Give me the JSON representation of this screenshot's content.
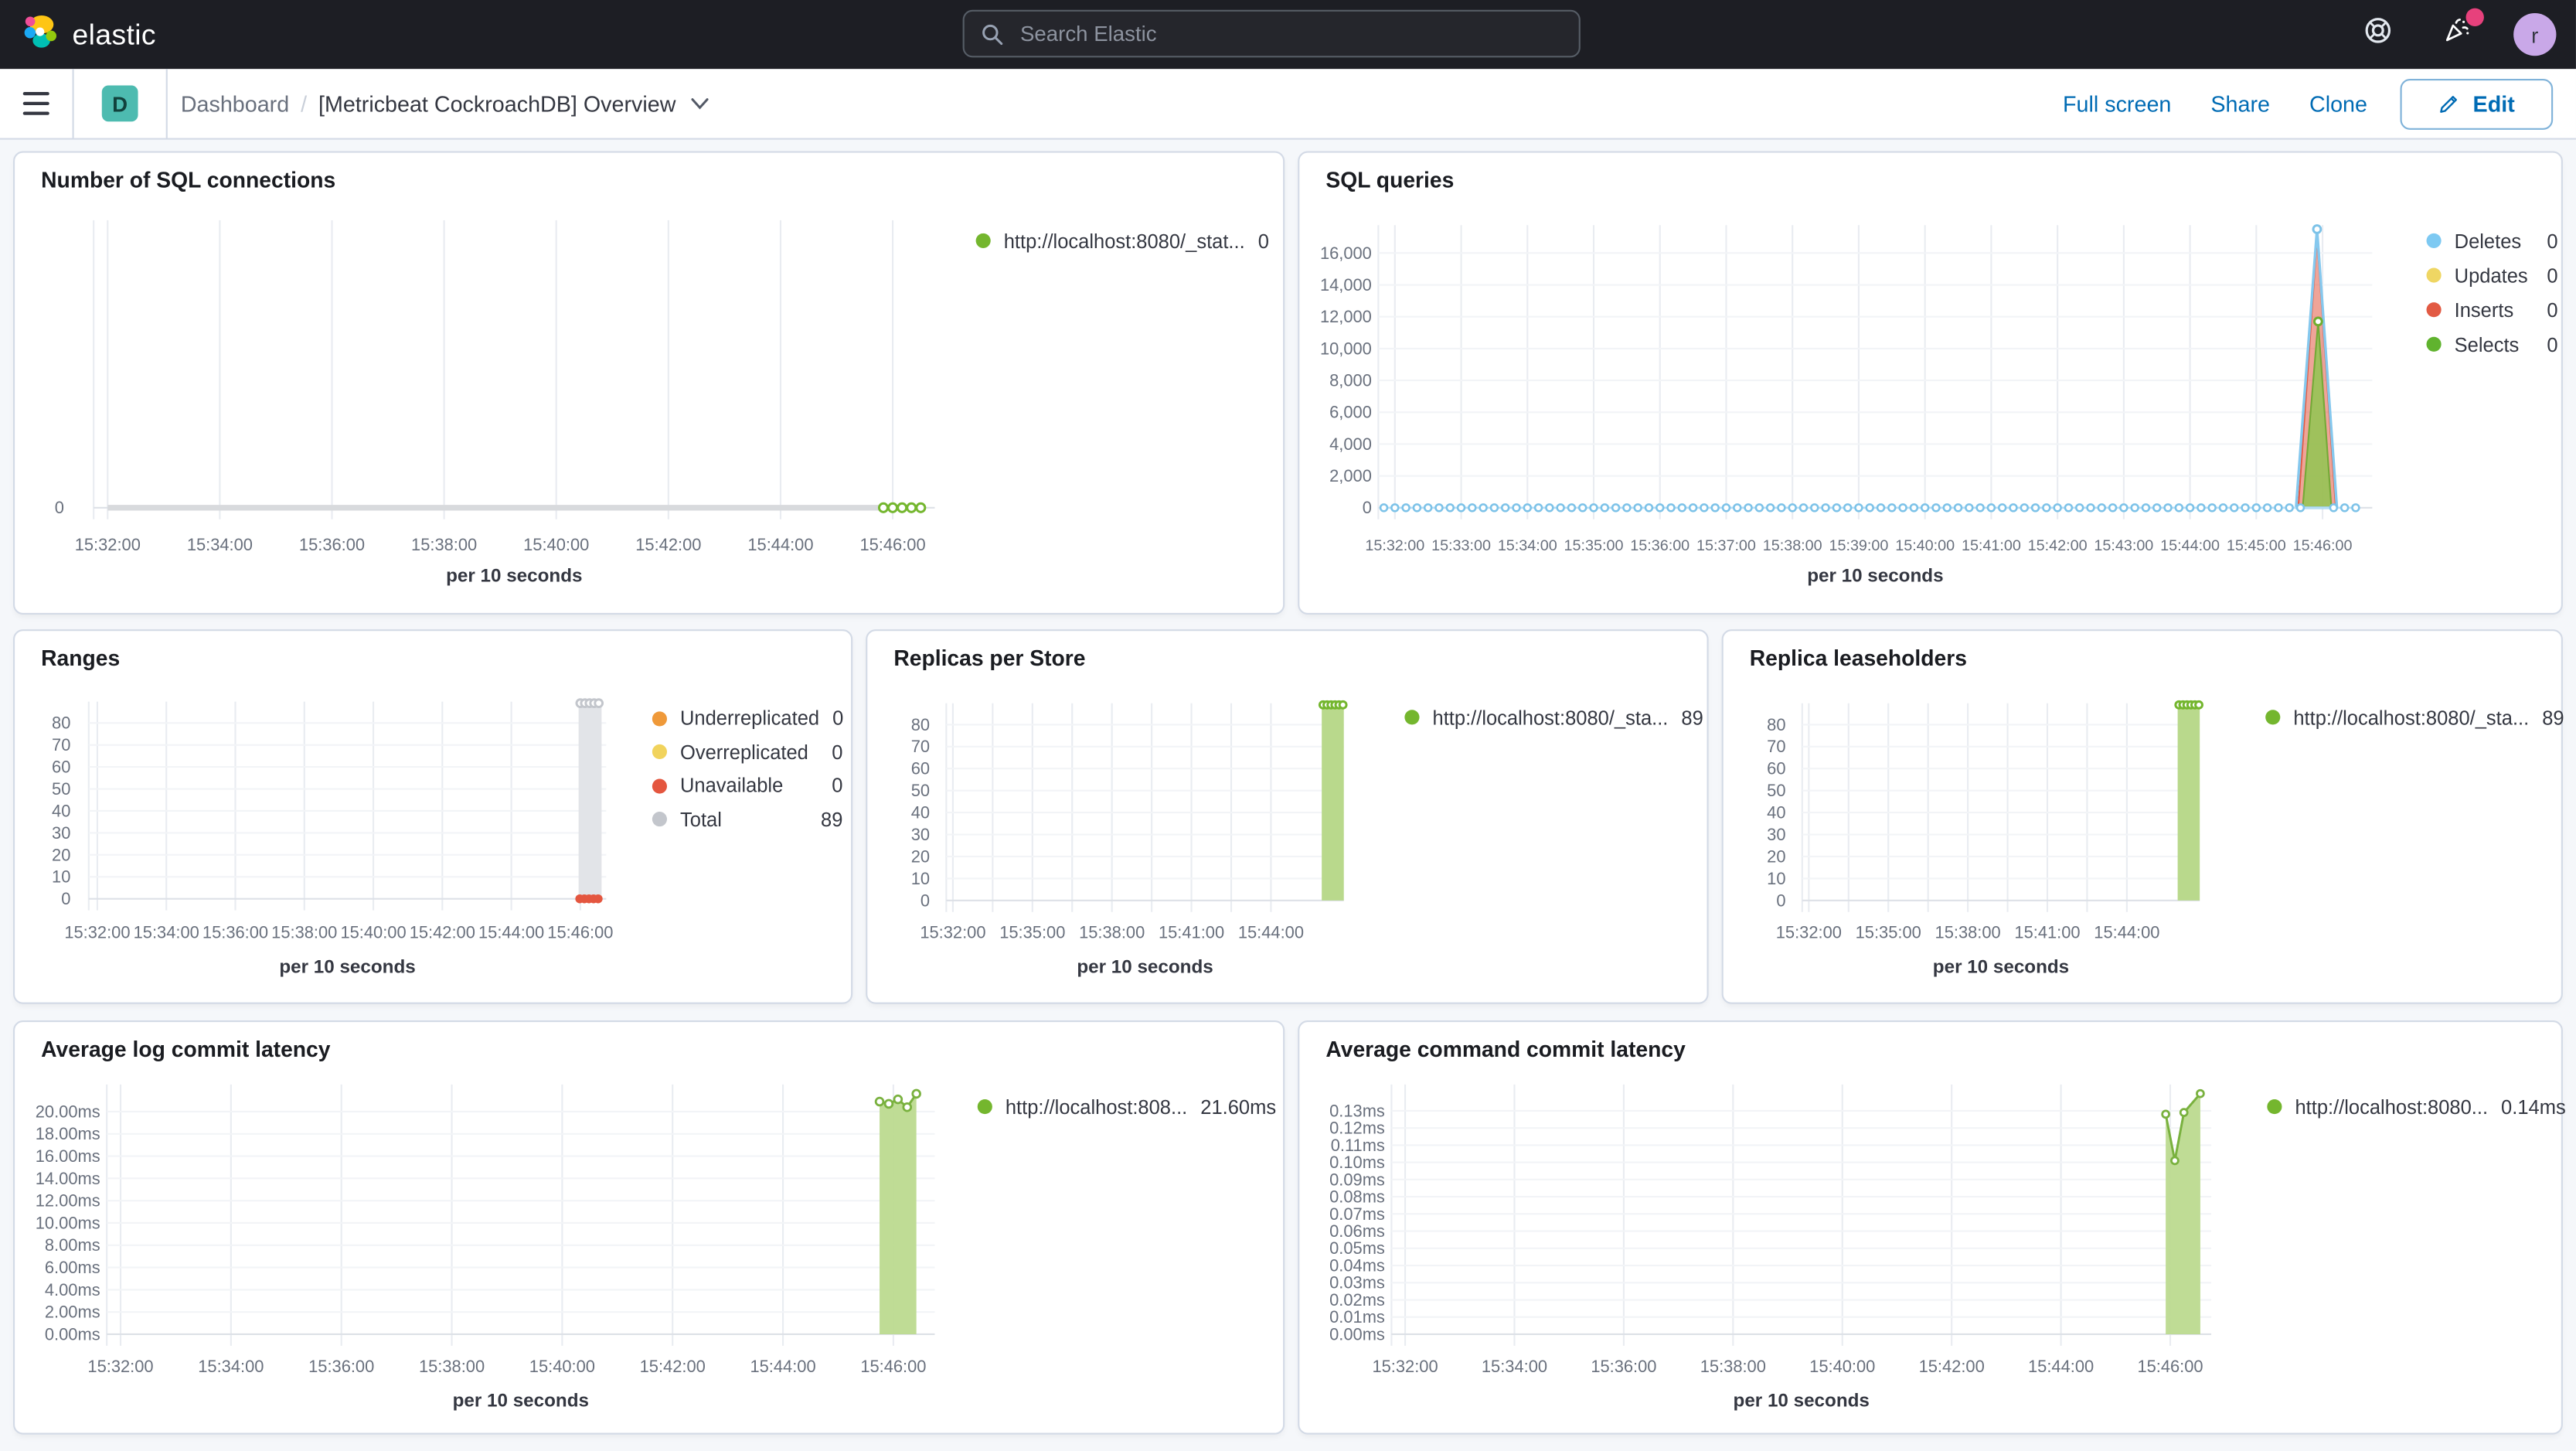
{
  "chrome": {
    "brand": "elastic",
    "search_placeholder": "Search Elastic",
    "avatar_initial": "r",
    "notification_color": "#e7417c"
  },
  "toolbar": {
    "badge": "D",
    "breadcrumb_root": "Dashboard",
    "breadcrumb_sep": "/",
    "title": "[Metricbeat CockroachDB] Overview",
    "actions": [
      "Full screen",
      "Share",
      "Clone"
    ],
    "edit_label": "Edit"
  },
  "colors": {
    "topbar_bg": "#1d1e24",
    "page_bg": "#f5f7fa",
    "panel_border": "#d3dae6",
    "link_blue": "#006bb4",
    "green_series": "#74b62e",
    "green_fill": "#bcda8f",
    "blue_series": "#7cc2e8",
    "red_series": "#e25a43",
    "yellow_series": "#efd663",
    "orange_series": "#ef9939",
    "gray_series": "#c3c6cc"
  },
  "chart_data": {
    "sql_connections": {
      "type": "line",
      "title": "Number of SQL connections",
      "xlabel": "per 10 seconds",
      "time_range": [
        "15:31:45",
        "15:46:45"
      ],
      "x_ticks": [
        "15:32:00",
        "15:34:00",
        "15:36:00",
        "15:38:00",
        "15:40:00",
        "15:42:00",
        "15:44:00",
        "15:46:00"
      ],
      "y_ticks": [
        [
          "0",
          0
        ]
      ],
      "legend": [
        {
          "label": "http://localhost:8080/_stat...",
          "value": "0",
          "color": "#74b62e"
        }
      ],
      "draw": [
        {
          "kind": "hline",
          "v": 0,
          "t0": "15:32:00",
          "t1": "15:45:50",
          "color": "#d8dadd",
          "w": 3.5
        },
        {
          "kind": "hollow",
          "r": 2.6,
          "color": "#74b62e",
          "pts": [
            [
              "15:45:50",
              0
            ],
            [
              "15:46:00",
              0
            ],
            [
              "15:46:10",
              0
            ],
            [
              "15:46:20",
              0
            ],
            [
              "15:46:30",
              0
            ]
          ]
        }
      ]
    },
    "sql_queries": {
      "type": "line",
      "title": "SQL queries",
      "xlabel": "per 10 seconds",
      "time_range": [
        "15:31:45",
        "15:46:45"
      ],
      "x_ticks": [
        "15:32:00",
        "15:33:00",
        "15:34:00",
        "15:35:00",
        "15:36:00",
        "15:37:00",
        "15:38:00",
        "15:39:00",
        "15:40:00",
        "15:41:00",
        "15:42:00",
        "15:43:00",
        "15:44:00",
        "15:45:00",
        "15:46:00"
      ],
      "y_ticks": [
        [
          "16,000",
          16000
        ],
        [
          "14,000",
          14000
        ],
        [
          "12,000",
          12000
        ],
        [
          "10,000",
          10000
        ],
        [
          "8,000",
          8000
        ],
        [
          "6,000",
          6000
        ],
        [
          "4,000",
          4000
        ],
        [
          "2,000",
          2000
        ],
        [
          "0",
          0
        ]
      ],
      "legend": [
        {
          "label": "Deletes",
          "value": "0",
          "color": "#7dc9f2"
        },
        {
          "label": "Updates",
          "value": "0",
          "color": "#efd663"
        },
        {
          "label": "Inserts",
          "value": "0",
          "color": "#e25a43"
        },
        {
          "label": "Selects",
          "value": "0",
          "color": "#60b32e"
        }
      ],
      "draw": [
        {
          "kind": "spike",
          "tl": "15:45:38",
          "tc": "15:45:55",
          "tr": "15:46:12",
          "v": 17000,
          "fill": "rgba(226,90,67,0.55)",
          "stroke": "#e25a43",
          "sw": 1
        },
        {
          "kind": "spike",
          "tl": "15:45:42",
          "tc": "15:45:56",
          "tr": "15:46:08",
          "v": 11700,
          "fill": "rgba(150,196,85,0.9)",
          "stroke": "#74a937",
          "sw": 1
        },
        {
          "kind": "spike",
          "tl": "15:45:36",
          "tc": "15:45:55",
          "tr": "15:46:13",
          "v": 17500,
          "fill": "none",
          "stroke": "#85c8ee",
          "sw": 1.6
        },
        {
          "kind": "dotline",
          "v": 0,
          "t0": "15:31:50",
          "t1": "15:46:30",
          "step": 10,
          "line": "#b5ddf4",
          "lw": 1.2,
          "stroke": "#7cc2e8",
          "r": 2.1,
          "skip": [
            "15:45:40",
            "15:46:10"
          ]
        },
        {
          "kind": "hollow",
          "r": 2.3,
          "color": "#7cc2e8",
          "pts": [
            [
              "15:45:55",
              17500
            ]
          ]
        },
        {
          "kind": "hollow",
          "r": 2.3,
          "color": "#6fae2f",
          "pts": [
            [
              "15:45:56",
              11700
            ]
          ]
        }
      ]
    },
    "ranges": {
      "type": "bar",
      "title": "Ranges",
      "xlabel": "per 10 seconds",
      "time_range": [
        "15:31:45",
        "15:46:45"
      ],
      "x_ticks": [
        "15:32:00",
        "15:34:00",
        "15:36:00",
        "15:38:00",
        "15:40:00",
        "15:42:00",
        "15:44:00",
        "15:46:00"
      ],
      "y_ticks": [
        [
          "80",
          80
        ],
        [
          "70",
          70
        ],
        [
          "60",
          60
        ],
        [
          "50",
          50
        ],
        [
          "40",
          40
        ],
        [
          "30",
          30
        ],
        [
          "20",
          20
        ],
        [
          "10",
          10
        ],
        [
          "0",
          0
        ]
      ],
      "legend": [
        {
          "label": "Underreplicated",
          "value": "0",
          "color": "#ef9939"
        },
        {
          "label": "Overreplicated",
          "value": "0",
          "color": "#f1d35c"
        },
        {
          "label": "Unavailable",
          "value": "0",
          "color": "#e4563f"
        },
        {
          "label": "Total",
          "value": "89",
          "color": "#c3c6cc"
        }
      ],
      "draw": [
        {
          "kind": "bar",
          "t0": "15:45:57",
          "t1": "15:46:37",
          "v": 89,
          "fill": "#e2e4e8"
        },
        {
          "kind": "hollow",
          "r": 2.3,
          "color": "#c3c6cc",
          "pts": [
            [
              "15:46:00",
              89
            ],
            [
              "15:46:08",
              89
            ],
            [
              "15:46:16",
              89
            ],
            [
              "15:46:24",
              89
            ],
            [
              "15:46:32",
              89
            ]
          ]
        },
        {
          "kind": "dots",
          "r": 2.7,
          "color": "#e4563f",
          "pts": [
            [
              "15:45:59",
              0
            ],
            [
              "15:46:07",
              0
            ],
            [
              "15:46:15",
              0
            ],
            [
              "15:46:23",
              0
            ],
            [
              "15:46:31",
              0
            ]
          ]
        }
      ]
    },
    "replicas_per_store": {
      "type": "bar",
      "title": "Replicas per Store",
      "xlabel": "per 10 seconds",
      "time_range": [
        "15:31:45",
        "15:46:45"
      ],
      "x_ticks": [
        "15:32:00",
        "15:35:00",
        "15:38:00",
        "15:41:00",
        "15:44:00"
      ],
      "y_ticks": [
        [
          "80",
          80
        ],
        [
          "70",
          70
        ],
        [
          "60",
          60
        ],
        [
          "50",
          50
        ],
        [
          "40",
          40
        ],
        [
          "30",
          30
        ],
        [
          "20",
          20
        ],
        [
          "10",
          10
        ],
        [
          "0",
          0
        ]
      ],
      "legend": [
        {
          "label": "http://localhost:8080/_sta...",
          "value": "89",
          "color": "#74b62e"
        }
      ],
      "draw": [
        {
          "kind": "bar",
          "t0": "15:45:55",
          "t1": "15:46:45",
          "v": 89,
          "fill": "#b9d98c"
        },
        {
          "kind": "hollow",
          "r": 2.1,
          "color": "#74b62e",
          "pts": [
            [
              "15:45:58",
              89
            ],
            [
              "15:46:07",
              89
            ],
            [
              "15:46:16",
              89
            ],
            [
              "15:46:25",
              89
            ],
            [
              "15:46:34",
              89
            ],
            [
              "15:46:43",
              89
            ]
          ]
        }
      ]
    },
    "replica_leaseholders": {
      "type": "bar",
      "title": "Replica leaseholders",
      "xlabel": "per 10 seconds",
      "time_range": [
        "15:31:45",
        "15:46:45"
      ],
      "x_ticks": [
        "15:32:00",
        "15:35:00",
        "15:38:00",
        "15:41:00",
        "15:44:00"
      ],
      "y_ticks": [
        [
          "80",
          80
        ],
        [
          "70",
          70
        ],
        [
          "60",
          60
        ],
        [
          "50",
          50
        ],
        [
          "40",
          40
        ],
        [
          "30",
          30
        ],
        [
          "20",
          20
        ],
        [
          "10",
          10
        ],
        [
          "0",
          0
        ]
      ],
      "legend": [
        {
          "label": "http://localhost:8080/_sta...",
          "value": "89",
          "color": "#74b62e"
        }
      ],
      "draw": [
        {
          "kind": "bar",
          "t0": "15:45:55",
          "t1": "15:46:45",
          "v": 89,
          "fill": "#b9d98c"
        },
        {
          "kind": "hollow",
          "r": 2.1,
          "color": "#74b62e",
          "pts": [
            [
              "15:45:58",
              89
            ],
            [
              "15:46:07",
              89
            ],
            [
              "15:46:16",
              89
            ],
            [
              "15:46:25",
              89
            ],
            [
              "15:46:34",
              89
            ],
            [
              "15:46:43",
              89
            ]
          ]
        }
      ]
    },
    "avg_log_commit_latency": {
      "type": "area",
      "title": "Average log commit latency",
      "xlabel": "per 10 seconds",
      "time_range": [
        "15:31:45",
        "15:46:45"
      ],
      "x_ticks": [
        "15:32:00",
        "15:34:00",
        "15:36:00",
        "15:38:00",
        "15:40:00",
        "15:42:00",
        "15:44:00",
        "15:46:00"
      ],
      "y_ticks": [
        [
          "20.00ms",
          20
        ],
        [
          "18.00ms",
          18
        ],
        [
          "16.00ms",
          16
        ],
        [
          "14.00ms",
          14
        ],
        [
          "12.00ms",
          12
        ],
        [
          "10.00ms",
          10
        ],
        [
          "8.00ms",
          8
        ],
        [
          "6.00ms",
          6
        ],
        [
          "4.00ms",
          4
        ],
        [
          "2.00ms",
          2
        ],
        [
          "0.00ms",
          0
        ]
      ],
      "legend": [
        {
          "label": "http://localhost:808...",
          "value": "21.60ms",
          "color": "#74b62e"
        }
      ],
      "draw": [
        {
          "kind": "area",
          "fill": "rgba(188,218,143,0.95)",
          "stroke": "#79b13e",
          "sw": 1.4,
          "mr": 2.3,
          "pts": [
            [
              "15:45:45",
              20.9
            ],
            [
              "15:45:55",
              20.7
            ],
            [
              "15:46:05",
              21.1
            ],
            [
              "15:46:15",
              20.4
            ],
            [
              "15:46:25",
              21.6
            ]
          ]
        }
      ]
    },
    "avg_command_commit_latency": {
      "type": "area",
      "title": "Average command commit latency",
      "xlabel": "per 10 seconds",
      "time_range": [
        "15:31:45",
        "15:46:45"
      ],
      "x_ticks": [
        "15:32:00",
        "15:34:00",
        "15:36:00",
        "15:38:00",
        "15:40:00",
        "15:42:00",
        "15:44:00",
        "15:46:00"
      ],
      "y_ticks": [
        [
          "0.13ms",
          0.13
        ],
        [
          "0.12ms",
          0.12
        ],
        [
          "0.11ms",
          0.11
        ],
        [
          "0.10ms",
          0.1
        ],
        [
          "0.09ms",
          0.09
        ],
        [
          "0.08ms",
          0.08
        ],
        [
          "0.07ms",
          0.07
        ],
        [
          "0.06ms",
          0.06
        ],
        [
          "0.05ms",
          0.05
        ],
        [
          "0.04ms",
          0.04
        ],
        [
          "0.03ms",
          0.03
        ],
        [
          "0.02ms",
          0.02
        ],
        [
          "0.01ms",
          0.01
        ],
        [
          "0.00ms",
          0
        ]
      ],
      "legend": [
        {
          "label": "http://localhost:8080...",
          "value": "0.14ms",
          "color": "#74b62e"
        }
      ],
      "draw": [
        {
          "kind": "area",
          "fill": "rgba(188,218,143,0.95)",
          "stroke": "#79b13e",
          "sw": 1.4,
          "mr": 2.1,
          "pts": [
            [
              "15:45:55",
              0.128
            ],
            [
              "15:46:05",
              0.101
            ],
            [
              "15:46:15",
              0.129
            ],
            [
              "15:46:33",
              0.14
            ]
          ]
        }
      ]
    }
  }
}
